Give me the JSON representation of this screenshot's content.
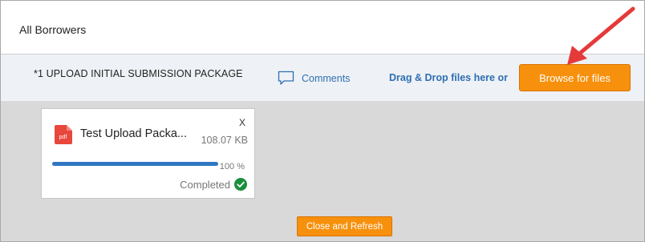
{
  "header": {
    "title": "All Borrowers"
  },
  "upload_section": {
    "title": "*1 UPLOAD INITIAL SUBMISSION PACKAGE",
    "comments_label": "Comments",
    "drag_drop_text": "Drag & Drop files here or",
    "browse_button": "Browse for files"
  },
  "file_card": {
    "icon_text": "pdf",
    "file_name": "Test Upload Packa...",
    "file_size": "108.07 KB",
    "close_label": "X",
    "progress_percent": 100,
    "progress_text": "100 %",
    "status": "Completed"
  },
  "footer": {
    "close_refresh_button": "Close and Refresh"
  },
  "colors": {
    "accent_orange": "#f7900c",
    "link_blue": "#2f6fb3",
    "progress_blue": "#2f77c2",
    "success_green": "#1a8f3c",
    "pdf_red": "#e8473c",
    "annotation_arrow": "#e53a3a"
  },
  "icons": {
    "comments": "speech-bubble-icon",
    "file": "pdf-file-icon",
    "status": "check-circle-icon",
    "annotation": "red-arrow-annotation"
  }
}
